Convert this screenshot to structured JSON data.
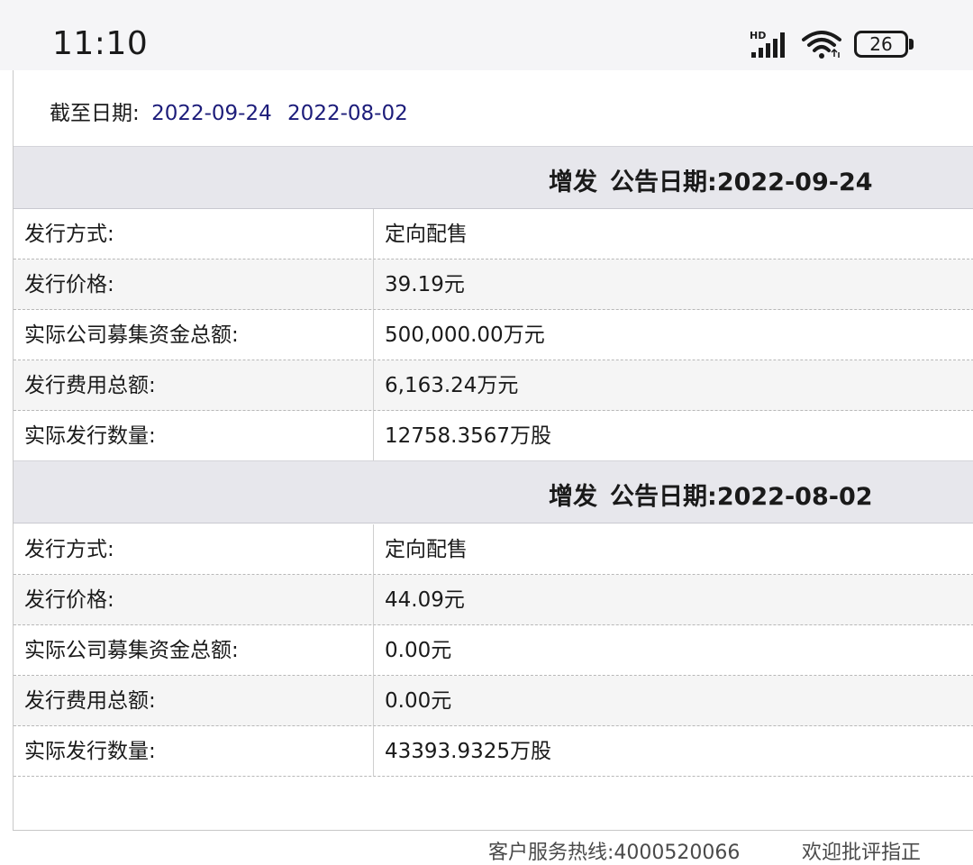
{
  "status_bar": {
    "time": "11:10",
    "hd_label": "HD",
    "battery": "26",
    "icons": [
      "hd-signal-icon",
      "wifi-icon",
      "battery-icon"
    ]
  },
  "cutoff": {
    "label": "截至日期:",
    "dates": [
      "2022-09-24",
      "2022-08-02"
    ]
  },
  "sections": [
    {
      "type": "增发",
      "date_label": "公告日期:",
      "date": "2022-09-24",
      "rows": [
        {
          "label": "发行方式:",
          "value": "定向配售"
        },
        {
          "label": "发行价格:",
          "value": "39.19元"
        },
        {
          "label": "实际公司募集资金总额:",
          "value": "500,000.00万元"
        },
        {
          "label": "发行费用总额:",
          "value": "6,163.24万元"
        },
        {
          "label": "实际发行数量:",
          "value": "12758.3567万股"
        }
      ]
    },
    {
      "type": "增发",
      "date_label": "公告日期:",
      "date": "2022-08-02",
      "rows": [
        {
          "label": "发行方式:",
          "value": "定向配售"
        },
        {
          "label": "发行价格:",
          "value": "44.09元"
        },
        {
          "label": "实际公司募集资金总额:",
          "value": "0.00元"
        },
        {
          "label": "发行费用总额:",
          "value": "0.00元"
        },
        {
          "label": "实际发行数量:",
          "value": "43393.9325万股"
        }
      ]
    }
  ],
  "footer": {
    "hotline": "客户服务热线:4000520066",
    "feedback": "欢迎批评指正"
  },
  "colors": {
    "link": "#1c1c7a",
    "section_header_bg": "#e7e7ec",
    "row_alt_bg": "#f5f5f5"
  }
}
